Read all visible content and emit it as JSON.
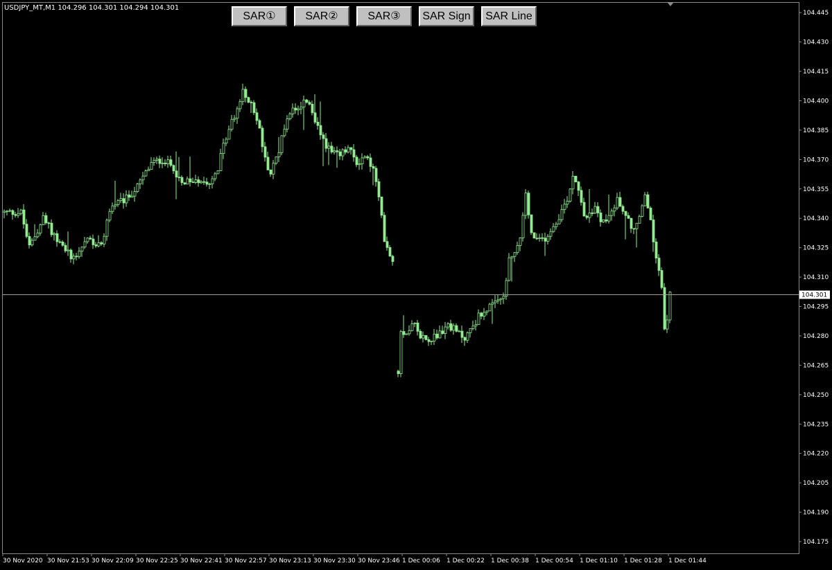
{
  "symbol_info": "USDJPY_MT,M1  104.296 104.301 104.294 104.301",
  "toolbar": {
    "sar1_label": "SAR①",
    "sar2_label": "SAR②",
    "sar3_label": "SAR③",
    "sar_sign_label": "SAR Sign",
    "sar_line_label": "SAR Line"
  },
  "colors": {
    "background": "#000000",
    "candle": "#90ee90",
    "grid_frame": "#8a8a8a",
    "axis_text": "#ffffff",
    "price_line": "#a0a0a0"
  },
  "chart_data": {
    "type": "candlestick",
    "title": "",
    "xlabel": "",
    "ylabel": "",
    "grid": false,
    "ylim": [
      104.169,
      104.45
    ],
    "y_ticks": [
      "104.445",
      "104.430",
      "104.415",
      "104.400",
      "104.385",
      "104.370",
      "104.355",
      "104.340",
      "104.325",
      "104.310",
      "104.295",
      "104.280",
      "104.265",
      "104.250",
      "104.235",
      "104.220",
      "104.205",
      "104.190",
      "104.175"
    ],
    "x_ticks": [
      "30 Nov 2020",
      "30 Nov 21:53",
      "30 Nov 22:09",
      "30 Nov 22:25",
      "30 Nov 22:41",
      "30 Nov 22:57",
      "30 Nov 23:13",
      "30 Nov 23:30",
      "30 Nov 23:46",
      "1 Dec 00:06",
      "1 Dec 00:22",
      "1 Dec 00:38",
      "1 Dec 00:54",
      "1 Dec 01:10",
      "1 Dec 01:28",
      "1 Dec 01:44"
    ],
    "current_price": "104.301",
    "anchors": [
      [
        0,
        104.343
      ],
      [
        6,
        104.343
      ],
      [
        9,
        104.325
      ],
      [
        14,
        104.34
      ],
      [
        21,
        104.325
      ],
      [
        25,
        104.32
      ],
      [
        30,
        104.33
      ],
      [
        35,
        104.325
      ],
      [
        38,
        104.345
      ],
      [
        44,
        104.35
      ],
      [
        48,
        104.356
      ],
      [
        53,
        104.368
      ],
      [
        57,
        104.37
      ],
      [
        61,
        104.366
      ],
      [
        64,
        104.357
      ],
      [
        69,
        104.36
      ],
      [
        74,
        104.359
      ],
      [
        77,
        104.366
      ],
      [
        80,
        104.382
      ],
      [
        84,
        104.396
      ],
      [
        86,
        104.404
      ],
      [
        88,
        104.401
      ],
      [
        90,
        104.395
      ],
      [
        92,
        104.385
      ],
      [
        94,
        104.37
      ],
      [
        96,
        104.363
      ],
      [
        99,
        104.375
      ],
      [
        102,
        104.392
      ],
      [
        104,
        104.396
      ],
      [
        107,
        104.398
      ],
      [
        109,
        104.4
      ],
      [
        112,
        104.39
      ],
      [
        115,
        104.38
      ],
      [
        118,
        104.373
      ],
      [
        121,
        104.372
      ],
      [
        124,
        104.376
      ],
      [
        127,
        104.368
      ],
      [
        130,
        104.372
      ],
      [
        133,
        104.365
      ],
      [
        135,
        104.35
      ],
      [
        137,
        104.33
      ],
      [
        139,
        104.322
      ],
      [
        140,
        104.318
      ],
      [
        142,
        104.262
      ],
      [
        143,
        104.283
      ],
      [
        145,
        104.281
      ],
      [
        147,
        104.288
      ],
      [
        149,
        104.282
      ],
      [
        152,
        104.278
      ],
      [
        155,
        104.28
      ],
      [
        158,
        104.282
      ],
      [
        160,
        104.286
      ],
      [
        163,
        104.282
      ],
      [
        166,
        104.279
      ],
      [
        168,
        104.283
      ],
      [
        171,
        104.29
      ],
      [
        174,
        104.294
      ],
      [
        177,
        104.296
      ],
      [
        180,
        104.3
      ],
      [
        182,
        104.318
      ],
      [
        184,
        104.322
      ],
      [
        186,
        104.33
      ],
      [
        188,
        104.352
      ],
      [
        190,
        104.332
      ],
      [
        192,
        104.328
      ],
      [
        195,
        104.33
      ],
      [
        198,
        104.336
      ],
      [
        201,
        104.344
      ],
      [
        203,
        104.35
      ],
      [
        205,
        104.362
      ],
      [
        207,
        104.356
      ],
      [
        209,
        104.342
      ],
      [
        211,
        104.341
      ],
      [
        213,
        104.346
      ],
      [
        215,
        104.34
      ],
      [
        217,
        104.338
      ],
      [
        219,
        104.345
      ],
      [
        221,
        104.349
      ],
      [
        223,
        104.345
      ],
      [
        225,
        104.339
      ],
      [
        227,
        104.334
      ],
      [
        229,
        104.34
      ],
      [
        231,
        104.352
      ],
      [
        233,
        104.338
      ],
      [
        235,
        104.32
      ],
      [
        237,
        104.305
      ],
      [
        238,
        104.283
      ],
      [
        239,
        104.29
      ],
      [
        240,
        104.301
      ]
    ]
  }
}
